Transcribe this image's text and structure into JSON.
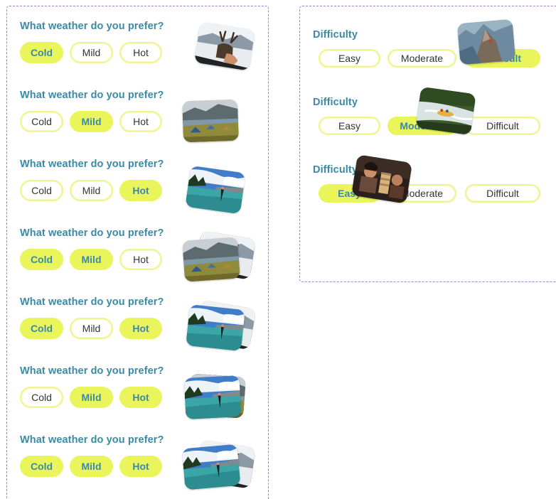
{
  "weather_question": "What weather do you prefer?",
  "weather_options": [
    "Cold",
    "Mild",
    "Hot"
  ],
  "weather_rows": [
    {
      "selected": [
        "Cold"
      ],
      "photo": "reindeer-snow-photo"
    },
    {
      "selected": [
        "Mild"
      ],
      "photo": "campsite-lake-photo"
    },
    {
      "selected": [
        "Hot"
      ],
      "photo": "lake-jump-photo"
    },
    {
      "selected": [
        "Cold",
        "Mild"
      ],
      "photo": "campsite-lake-photo"
    },
    {
      "selected": [
        "Cold",
        "Hot"
      ],
      "photo": "lake-jump-photo"
    },
    {
      "selected": [
        "Mild",
        "Hot"
      ],
      "photo": "lake-jump-photo"
    },
    {
      "selected": [
        "Cold",
        "Mild",
        "Hot"
      ],
      "photo": "lake-jump-photo"
    }
  ],
  "difficulty_question": "Difficulty",
  "difficulty_options": [
    "Easy",
    "Moderate",
    "Difficult"
  ],
  "difficulty_rows": [
    {
      "selected": [
        "Difficult"
      ],
      "photo": "mountain-climber-photo"
    },
    {
      "selected": [
        "Moderate"
      ],
      "photo": "river-rafting-photo"
    },
    {
      "selected": [
        "Easy"
      ],
      "photo": "board-game-photo"
    }
  ],
  "colors": {
    "accent_text": "#3a8aa6",
    "selected_fill": "#eaf55c",
    "unselected_border": "#eef48e",
    "panel_border": "#a77be0"
  }
}
